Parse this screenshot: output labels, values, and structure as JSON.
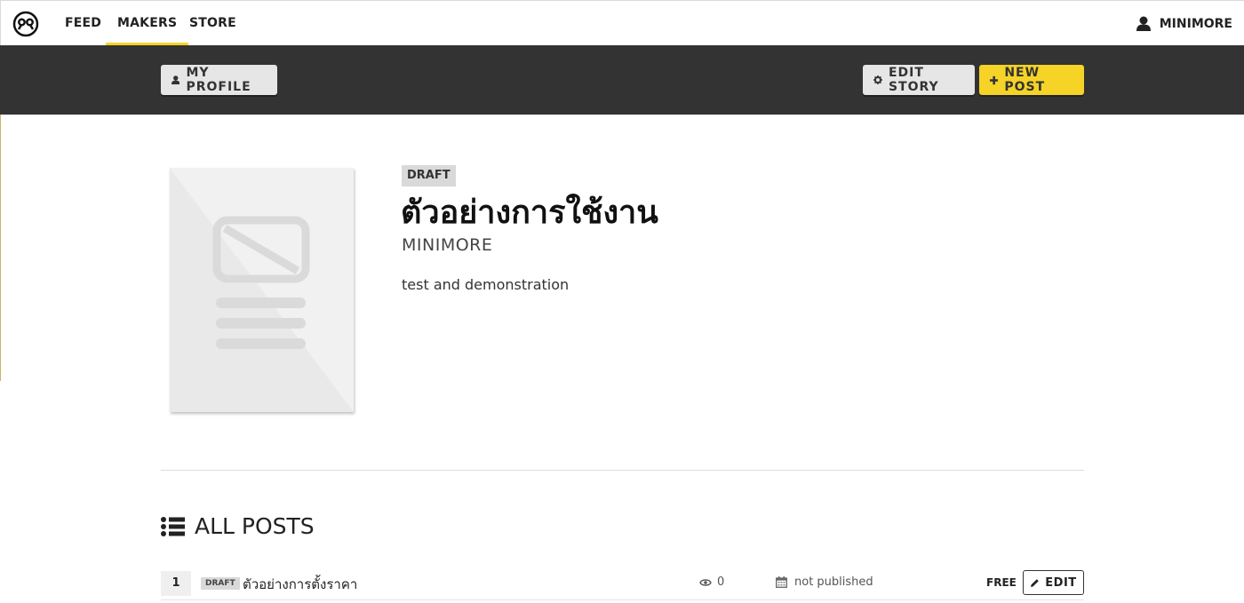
{
  "nav": {
    "links": [
      {
        "label": "FEED",
        "active": false
      },
      {
        "label": "MAKERS",
        "active": true
      },
      {
        "label": "STORE",
        "active": false
      }
    ],
    "user_label": "MINIMORE",
    "accent_color": "#f5d327"
  },
  "toolbar": {
    "my_profile_label": "MY PROFILE",
    "edit_story_label": "EDIT STORY",
    "new_post_label": "NEW POST"
  },
  "story": {
    "status": "DRAFT",
    "title": "ตัวอย่างการใช้งาน",
    "author": "MINIMORE",
    "description": "test and demonstration"
  },
  "posts_section": {
    "heading": "ALL POSTS",
    "posts": [
      {
        "number": "1",
        "status": "DRAFT",
        "title": "ตัวอย่างการตั้งราคา",
        "views": "0",
        "published": "not published",
        "price": "FREE",
        "edit_label": "EDIT"
      }
    ]
  }
}
